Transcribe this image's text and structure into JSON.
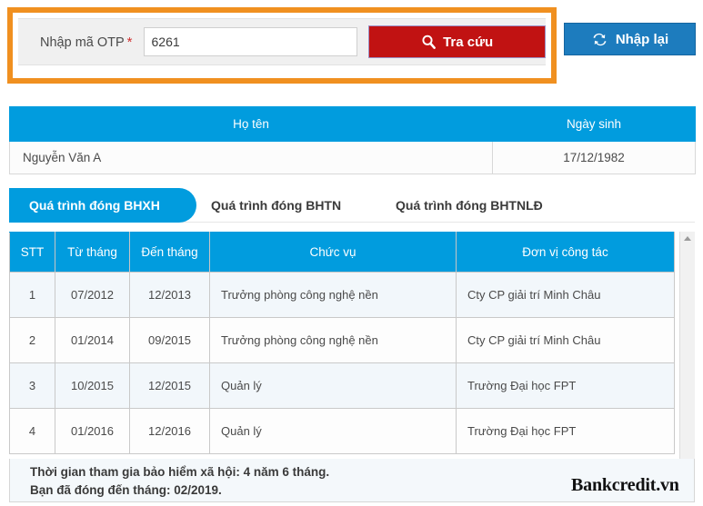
{
  "otp_panel": {
    "label": "Nhập mã OTP",
    "required_marker": "*",
    "input_value": "6261",
    "input_placeholder": "",
    "search_button": "Tra cứu",
    "search_icon": "magnifier-icon",
    "reset_button": "Nhập lại",
    "reset_icon": "refresh-icon",
    "highlight_color": "#F09020",
    "search_color": "#C11212",
    "reset_color": "#1D7CBE"
  },
  "person": {
    "headers": [
      "Họ tên",
      "Ngày sinh"
    ],
    "full_name": "Nguyễn Văn A",
    "birth_date": "17/12/1982"
  },
  "tabs": [
    {
      "label": "Quá trình đóng BHXH",
      "active": true
    },
    {
      "label": "Quá trình đóng BHTN",
      "active": false
    },
    {
      "label": "Quá trình đóng BHTNLĐ",
      "active": false
    }
  ],
  "grid": {
    "headers": [
      "STT",
      "Từ tháng",
      "Đến tháng",
      "Chức vụ",
      "Đơn vị công tác"
    ],
    "rows": [
      {
        "stt": "1",
        "from_month": "07/2012",
        "to_month": "12/2013",
        "position": "Trưởng phòng công nghệ nền",
        "organization": "Cty CP giải trí Minh Châu"
      },
      {
        "stt": "2",
        "from_month": "01/2014",
        "to_month": "09/2015",
        "position": "Trưởng phòng công nghệ nền",
        "organization": "Cty CP giải trí Minh Châu"
      },
      {
        "stt": "3",
        "from_month": "10/2015",
        "to_month": "12/2015",
        "position": "Quản lý",
        "organization": "Trường Đại học FPT"
      },
      {
        "stt": "4",
        "from_month": "01/2016",
        "to_month": "12/2016",
        "position": "Quản lý",
        "organization": "Trường Đại học FPT"
      }
    ],
    "accent_color": "#019CDE"
  },
  "summary": {
    "line1": "Thời gian tham gia bảo hiểm xã hội: 4 năm 6 tháng.",
    "line2": "Bạn đã đóng đến tháng: 02/2019."
  },
  "watermark": "Bankcredit.vn"
}
